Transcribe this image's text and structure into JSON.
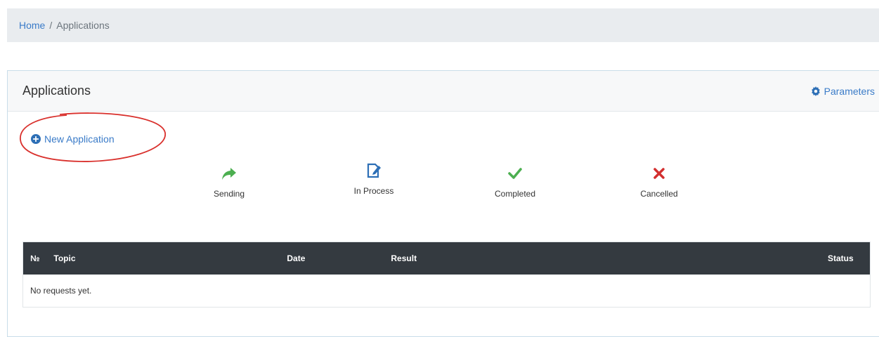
{
  "breadcrumb": {
    "home": "Home",
    "separator": "/",
    "current": "Applications"
  },
  "card": {
    "title": "Applications",
    "parameters_label": "Parameters"
  },
  "actions": {
    "new_application": "New Application"
  },
  "statuses": [
    {
      "label": "Sending",
      "icon": "share-arrow-icon",
      "color": "#4caf50"
    },
    {
      "label": "In Process",
      "icon": "edit-document-icon",
      "color": "#2d6fb6"
    },
    {
      "label": "Completed",
      "icon": "checkmark-icon",
      "color": "#4caf50"
    },
    {
      "label": "Cancelled",
      "icon": "cross-icon",
      "color": "#d32f2f"
    }
  ],
  "table": {
    "columns": [
      "№",
      "Topic",
      "Date",
      "Result",
      "Status"
    ],
    "empty_message": "No requests yet."
  },
  "colors": {
    "accent": "#3a7bc8",
    "table_header": "#343a40",
    "highlight_ring": "#d9302c"
  }
}
